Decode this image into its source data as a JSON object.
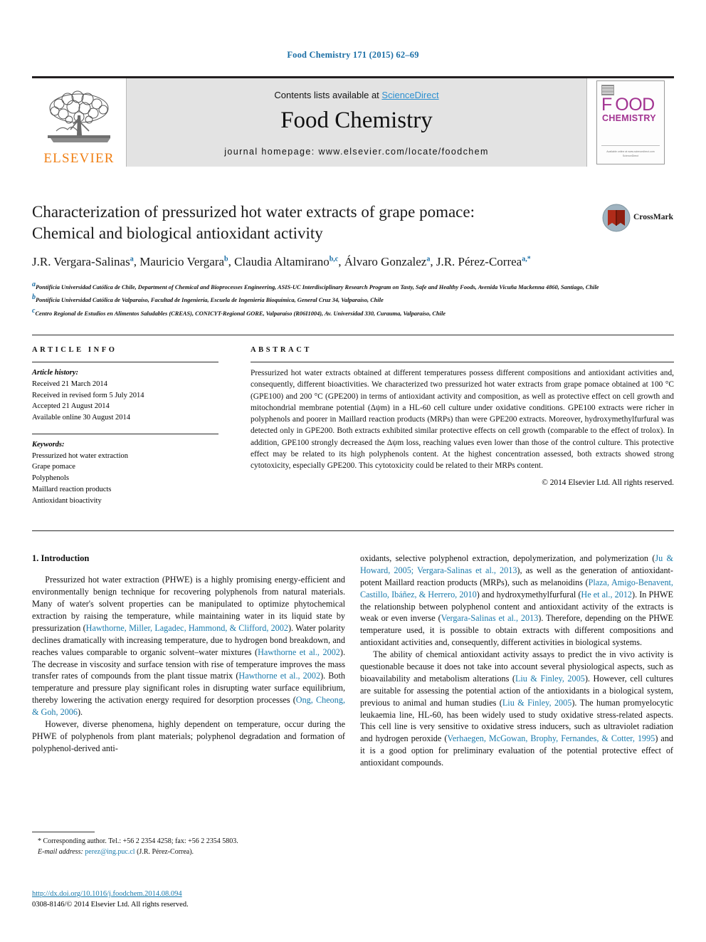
{
  "running_head": "Food Chemistry 171 (2015) 62–69",
  "masthead": {
    "contents_prefix": "Contents lists available at ",
    "sciencedirect": "ScienceDirect",
    "journal_title": "Food Chemistry",
    "homepage": "journal homepage: www.elsevier.com/locate/foodchem",
    "publisher_wordmark": "ELSEVIER",
    "cover": {
      "food": "F OOD",
      "chemistry": "CHEMISTRY",
      "footer_line1": "Available online at www.sciencedirect.com",
      "footer_line2": "ScienceDirect"
    }
  },
  "article": {
    "title_line1": "Characterization of pressurized hot water extracts of grape pomace:",
    "title_line2": "Chemical and biological antioxidant activity",
    "crossmark_label": "CrossMark",
    "authors": [
      {
        "name": "J.R. Vergara-Salinas",
        "marks": "a"
      },
      {
        "name": "Mauricio Vergara",
        "marks": "b"
      },
      {
        "name": "Claudia Altamirano",
        "marks": "b,c"
      },
      {
        "name": "Álvaro Gonzalez",
        "marks": "a"
      },
      {
        "name": "J.R. Pérez-Correa",
        "marks": "a,*"
      }
    ],
    "affiliations": [
      {
        "mark": "a",
        "text": "Pontificia Universidad Católica de Chile, Department of Chemical and Bioprocesses Engineering, ASIS-UC Interdisciplinary Research Program on Tasty, Safe and Healthy Foods, Avenida Vicuña Mackenna 4860, Santiago, Chile"
      },
      {
        "mark": "b",
        "text": "Pontificia Universidad Católica de Valparaíso, Facultad de Ingeniería, Escuela de Ingeniería Bioquímica, General Cruz 34, Valparaíso, Chile"
      },
      {
        "mark": "c",
        "text": "Centro Regional de Estudios en Alimentos Saludables (CREAS), CONICYT-Regional GORE, Valparaíso (R06I1004), Av. Universidad 330, Curauma, Valparaíso, Chile"
      }
    ]
  },
  "article_info": {
    "heading": "ARTICLE INFO",
    "history_label": "Article history:",
    "history": [
      "Received 21 March 2014",
      "Received in revised form 5 July 2014",
      "Accepted 21 August 2014",
      "Available online 30 August 2014"
    ],
    "keywords_label": "Keywords:",
    "keywords": [
      "Pressurized hot water extraction",
      "Grape pomace",
      "Polyphenols",
      "Maillard reaction products",
      "Antioxidant bioactivity"
    ]
  },
  "abstract": {
    "heading": "ABSTRACT",
    "text": "Pressurized hot water extracts obtained at different temperatures possess different compositions and antioxidant activities and, consequently, different bioactivities. We characterized two pressurized hot water extracts from grape pomace obtained at 100 °C (GPE100) and 200 °C (GPE200) in terms of antioxidant activity and composition, as well as protective effect on cell growth and mitochondrial membrane potential (Δψm) in a HL-60 cell culture under oxidative conditions. GPE100 extracts were richer in polyphenols and poorer in Maillard reaction products (MRPs) than were GPE200 extracts. Moreover, hydroxymethylfurfural was detected only in GPE200. Both extracts exhibited similar protective effects on cell growth (comparable to the effect of trolox). In addition, GPE100 strongly decreased the Δψm loss, reaching values even lower than those of the control culture. This protective effect may be related to its high polyphenols content. At the highest concentration assessed, both extracts showed strong cytotoxicity, especially GPE200. This cytotoxicity could be related to their MRPs content.",
    "copyright": "© 2014 Elsevier Ltd. All rights reserved."
  },
  "introduction": {
    "heading": "1. Introduction",
    "left": {
      "p1_a": "Pressurized hot water extraction (PHWE) is a highly promising energy-efficient and environmentally benign technique for recovering polyphenols from natural materials. Many of water's solvent properties can be manipulated to optimize phytochemical extraction by raising the temperature, while maintaining water in its liquid state by pressurization (",
      "p1_ref1": "Hawthorne, Miller, Lagadec, Hammond, & Clifford, 2002",
      "p1_b": "). Water polarity declines dramatically with increasing temperature, due to hydrogen bond breakdown, and reaches values comparable to organic solvent–water mixtures (",
      "p1_ref2": "Hawthorne et al., 2002",
      "p1_c": "). The decrease in viscosity and surface tension with rise of temperature improves the mass transfer rates of compounds from the plant tissue matrix (",
      "p1_ref3": "Hawthorne et al., 2002",
      "p1_d": "). Both temperature and pressure play significant roles in disrupting water surface equilibrium, thereby lowering the activation energy required for desorption processes (",
      "p1_ref4": "Ong, Cheong, & Goh, 2006",
      "p1_e": ").",
      "p2": "However, diverse phenomena, highly dependent on temperature, occur during the PHWE of polyphenols from plant materials; polyphenol degradation and formation of polyphenol-derived anti-"
    },
    "right": {
      "p1_a": "oxidants, selective polyphenol extraction, depolymerization, and polymerization (",
      "p1_ref1": "Ju & Howard, 2005; Vergara-Salinas et al., 2013",
      "p1_b": "), as well as the generation of antioxidant-potent Maillard reaction products (MRPs), such as melanoidins (",
      "p1_ref2": "Plaza, Amigo-Benavent, Castillo, Ibáñez, & Herrero, 2010",
      "p1_c": ") and hydroxymethylfurfural (",
      "p1_ref3": "He et al., 2012",
      "p1_d": "). In PHWE the relationship between polyphenol content and antioxidant activity of the extracts is weak or even inverse (",
      "p1_ref4": "Vergara-Salinas et al., 2013",
      "p1_e": "). Therefore, depending on the PHWE temperature used, it is possible to obtain extracts with different compositions and antioxidant activities and, consequently, different activities in biological systems.",
      "p2_a": "The ability of chemical antioxidant activity assays to predict the in vivo activity is questionable because it does not take into account several physiological aspects, such as bioavailability and metabolism alterations (",
      "p2_ref1": "Liu & Finley, 2005",
      "p2_b": "). However, cell cultures are suitable for assessing the potential action of the antioxidants in a biological system, previous to animal and human studies (",
      "p2_ref2": "Liu & Finley, 2005",
      "p2_c": "). The human promyelocytic leukaemia line, HL-60, has been widely used to study oxidative stress-related aspects. This cell line is very sensitive to oxidative stress inducers, such as ultraviolet radiation and hydrogen peroxide (",
      "p2_ref3": "Verhaegen, McGowan, Brophy, Fernandes, & Cotter, 1995",
      "p2_d": ") and it is a good option for preliminary evaluation of the potential protective effect of antioxidant compounds."
    }
  },
  "footnotes": {
    "corresponding": "* Corresponding author. Tel.: +56 2 2354 4258; fax: +56 2 2354 5803.",
    "email_label": "E-mail address:",
    "email": "perez@ing.puc.cl",
    "email_suffix": "(J.R. Pérez-Correa)."
  },
  "imprint": {
    "doi": "http://dx.doi.org/10.1016/j.foodchem.2014.08.094",
    "issn_line": "0308-8146/© 2014 Elsevier Ltd. All rights reserved."
  },
  "colors": {
    "link": "#1a7aab",
    "running_head": "#1a6ea5",
    "elsevier_orange": "#f07f13",
    "cover_magenta": "#a23391",
    "sciencedirect": "#2b8fd0"
  }
}
